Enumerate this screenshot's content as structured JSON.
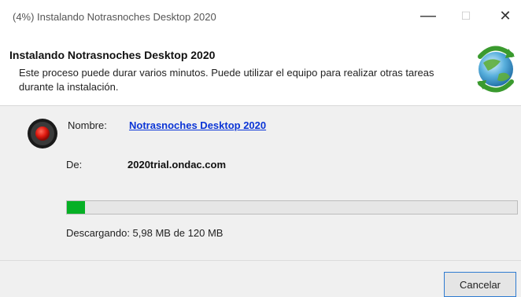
{
  "window": {
    "title": "(4%) Instalando Notrasnoches Desktop 2020",
    "minimize_glyph": "—",
    "maximize_glyph": "☐",
    "close_glyph": "✕"
  },
  "header": {
    "title": "Instalando Notrasnoches Desktop 2020",
    "description": "Este proceso puede durar varios minutos. Puede utilizar el equipo para realizar otras tareas durante la instalación.",
    "icon": "clickonce-install-icon"
  },
  "details": {
    "name_label": "Nombre:",
    "name_value": "Notrasnoches Desktop 2020",
    "from_label": "De:",
    "from_value": "2020trial.ondac.com",
    "status_icon": "record-icon"
  },
  "progress": {
    "percent": 4,
    "status_text": "Descargando: 5,98 MB de 120 MB",
    "fill_color": "#06b025"
  },
  "footer": {
    "cancel_label": "Cancelar"
  }
}
